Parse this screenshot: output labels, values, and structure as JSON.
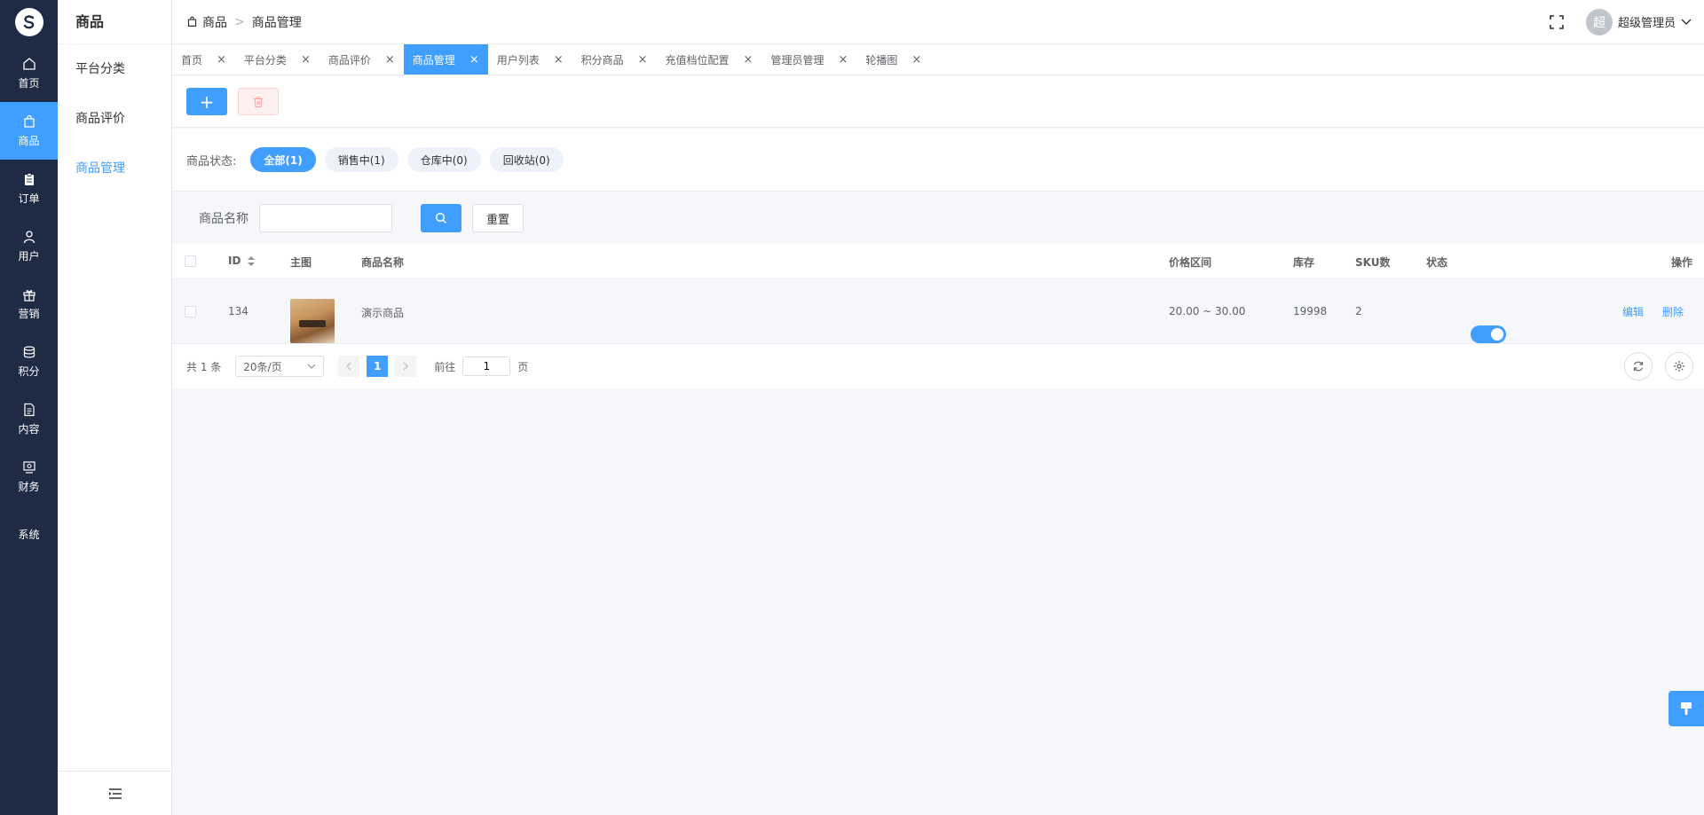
{
  "rail": {
    "logo_char": "S",
    "items": [
      {
        "label": "首页",
        "icon": "home-icon"
      },
      {
        "label": "商品",
        "icon": "bag-icon"
      },
      {
        "label": "订单",
        "icon": "clipboard-icon"
      },
      {
        "label": "用户",
        "icon": "user-icon"
      },
      {
        "label": "营销",
        "icon": "gift-icon"
      },
      {
        "label": "积分",
        "icon": "coins-icon"
      },
      {
        "label": "内容",
        "icon": "document-icon"
      },
      {
        "label": "财务",
        "icon": "finance-icon"
      },
      {
        "label": "系统",
        "icon": ""
      }
    ],
    "active_index": 1
  },
  "sidebar": {
    "title": "商品",
    "items": [
      {
        "label": "平台分类"
      },
      {
        "label": "商品评价"
      },
      {
        "label": "商品管理"
      }
    ],
    "active_index": 2
  },
  "header": {
    "breadcrumb": [
      "商品",
      "商品管理"
    ],
    "user": {
      "avatar_char": "超",
      "name": "超级管理员"
    }
  },
  "tabs": [
    {
      "label": "首页"
    },
    {
      "label": "平台分类"
    },
    {
      "label": "商品评价"
    },
    {
      "label": "商品管理"
    },
    {
      "label": "用户列表"
    },
    {
      "label": "积分商品"
    },
    {
      "label": "充值档位配置"
    },
    {
      "label": "管理员管理"
    },
    {
      "label": "轮播图"
    }
  ],
  "active_tab": 3,
  "toolbar": {
    "add_label": "+"
  },
  "status_filter": {
    "label": "商品状态:",
    "options": [
      {
        "label": "全部(1)"
      },
      {
        "label": "销售中(1)"
      },
      {
        "label": "仓库中(0)"
      },
      {
        "label": "回收站(0)"
      }
    ],
    "active_index": 0
  },
  "search": {
    "label": "商品名称",
    "value": "",
    "placeholder": "",
    "reset_label": "重置"
  },
  "table": {
    "columns": {
      "id": "ID",
      "image": "主图",
      "name": "商品名称",
      "price": "价格区间",
      "stock": "库存",
      "sku": "SKU数",
      "status": "状态",
      "actions": "操作"
    },
    "rows": [
      {
        "id": "134",
        "name": "演示商品",
        "price": "20.00 ~ 30.00",
        "stock": "19998",
        "sku": "2",
        "enabled": true,
        "edit_label": "编辑",
        "delete_label": "删除"
      }
    ]
  },
  "pagination": {
    "total_text": "共 1 条",
    "page_size": "20条/页",
    "current_page": "1",
    "goto_label": "前往",
    "goto_value": "1",
    "page_suffix": "页"
  },
  "colors": {
    "accent": "#409eff",
    "rail_bg": "#1f2a44"
  }
}
